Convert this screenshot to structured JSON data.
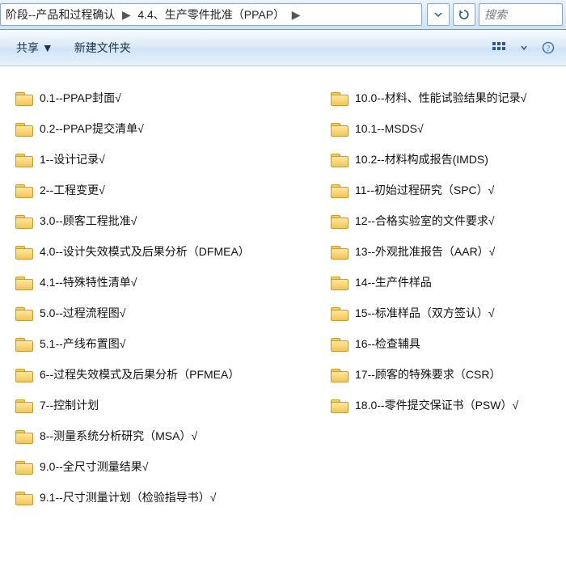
{
  "breadcrumb": {
    "seg1": "阶段--产品和过程确认",
    "seg2": "4.4、生产零件批准（PPAP）"
  },
  "search": {
    "placeholder": "搜索"
  },
  "toolbar": {
    "share": "共享 ▼",
    "newfolder": "新建文件夹"
  },
  "left": [
    {
      "n": "0.1--PPAP封面√"
    },
    {
      "n": "0.2--PPAP提交清单√"
    },
    {
      "n": "1--设计记录√"
    },
    {
      "n": "2--工程变更√"
    },
    {
      "n": "3.0--顾客工程批准√"
    },
    {
      "n": "4.0--设计失效模式及后果分析（DFMEA）"
    },
    {
      "n": "4.1--特殊特性清单√"
    },
    {
      "n": "5.0--过程流程图√"
    },
    {
      "n": "5.1--产线布置图√"
    },
    {
      "n": "6--过程失效模式及后果分析（PFMEA）"
    },
    {
      "n": "7--控制计划"
    },
    {
      "n": "8--测量系统分析研究（MSA）√"
    },
    {
      "n": "9.0--全尺寸测量结果√"
    },
    {
      "n": "9.1--尺寸测量计划（检验指导书）√"
    }
  ],
  "right": [
    {
      "n": "10.0--材料、性能试验结果的记录√"
    },
    {
      "n": "10.1--MSDS√"
    },
    {
      "n": "10.2--材料构成报告(IMDS)"
    },
    {
      "n": "11--初始过程研究（SPC）√"
    },
    {
      "n": "12--合格实验室的文件要求√"
    },
    {
      "n": "13--外观批准报告（AAR）√"
    },
    {
      "n": "14--生产件样品"
    },
    {
      "n": "15--标准样品（双方签认）√"
    },
    {
      "n": "16--检查辅具"
    },
    {
      "n": "17--顾客的特殊要求（CSR）"
    },
    {
      "n": "18.0--零件提交保证书（PSW）√"
    }
  ]
}
